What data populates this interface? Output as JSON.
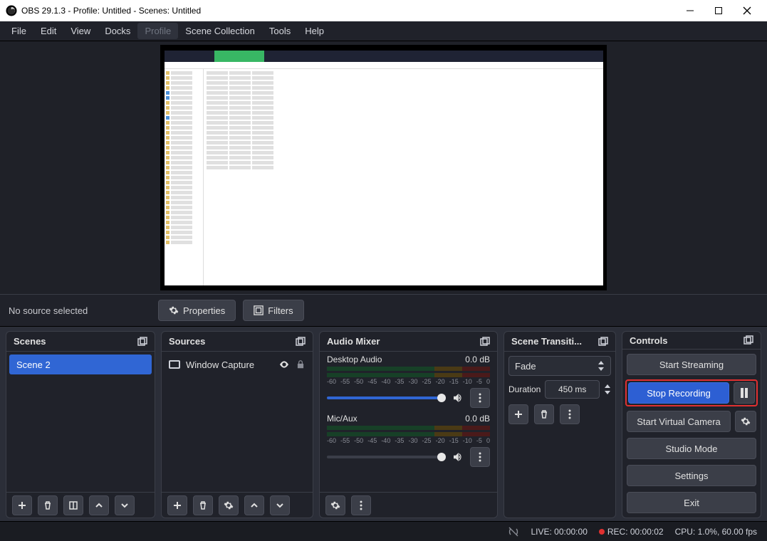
{
  "window": {
    "title": "OBS 29.1.3 - Profile: Untitled - Scenes: Untitled"
  },
  "menu": {
    "items": [
      "File",
      "Edit",
      "View",
      "Docks",
      "Profile",
      "Scene Collection",
      "Tools",
      "Help"
    ],
    "highlight_index": 4
  },
  "subtoolbar": {
    "no_source": "No source selected",
    "properties": "Properties",
    "filters": "Filters"
  },
  "scenes": {
    "title": "Scenes",
    "items": [
      {
        "name": "Scene 2",
        "active": true
      }
    ]
  },
  "sources": {
    "title": "Sources",
    "items": [
      {
        "name": "Window Capture",
        "visible": true,
        "locked": true
      }
    ]
  },
  "mixer": {
    "title": "Audio Mixer",
    "ticks": [
      "-60",
      "-55",
      "-50",
      "-45",
      "-40",
      "-35",
      "-30",
      "-25",
      "-20",
      "-15",
      "-10",
      "-5",
      "0"
    ],
    "channels": [
      {
        "name": "Desktop Audio",
        "level": "0.0 dB"
      },
      {
        "name": "Mic/Aux",
        "level": "0.0 dB"
      }
    ]
  },
  "transitions": {
    "title": "Scene Transiti...",
    "selected": "Fade",
    "duration_label": "Duration",
    "duration_value": "450 ms"
  },
  "controls": {
    "title": "Controls",
    "start_streaming": "Start Streaming",
    "stop_recording": "Stop Recording",
    "start_virtual_camera": "Start Virtual Camera",
    "studio_mode": "Studio Mode",
    "settings": "Settings",
    "exit": "Exit"
  },
  "status": {
    "live": "LIVE: 00:00:00",
    "rec": "REC: 00:00:02",
    "cpu": "CPU: 1.0%, 60.00 fps"
  }
}
